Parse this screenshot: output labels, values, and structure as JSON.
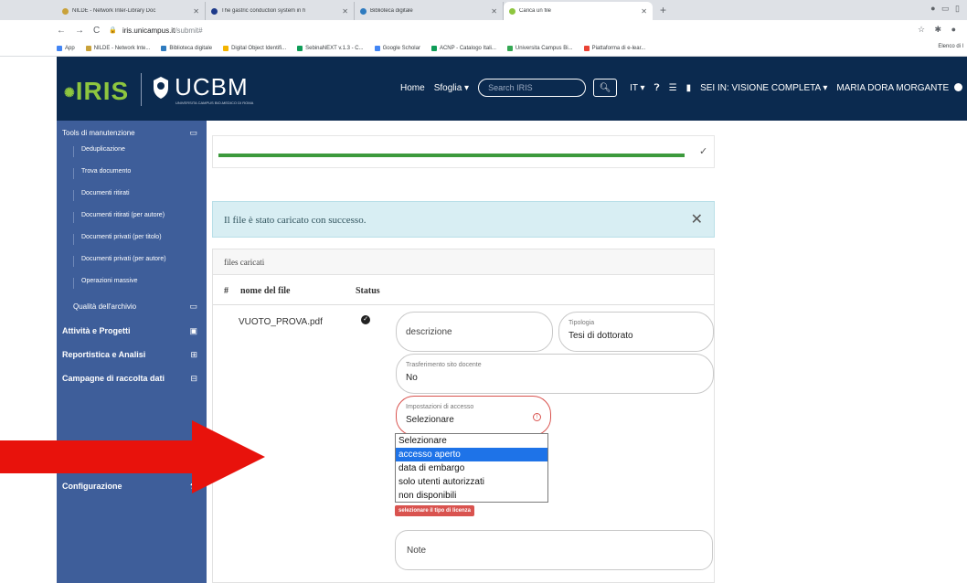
{
  "browser": {
    "tabs": [
      {
        "title": "NILDE - Network Inter-Library Doc",
        "fav": "#c9a23a",
        "active": false
      },
      {
        "title": "The gastric conduction system in h",
        "fav": "#1e3a8a",
        "active": false
      },
      {
        "title": "Biblioteca digitale",
        "fav": "#2e7bbf",
        "active": false
      },
      {
        "title": "Carica un file",
        "fav": "#8ec63f",
        "active": true
      }
    ],
    "url_host": "iris.unicampus.it",
    "url_path": "/submit#",
    "bookmarks": [
      {
        "label": "App",
        "color": "#4285f4"
      },
      {
        "label": "NILDE - Network Inte...",
        "color": "#c9a23a"
      },
      {
        "label": "Biblioteca digitale",
        "color": "#2e7bbf"
      },
      {
        "label": "Digital Object Identifi...",
        "color": "#f4b400"
      },
      {
        "label": "SebinaNEXT v.1.3 - C...",
        "color": "#0f9d58"
      },
      {
        "label": "Google Scholar",
        "color": "#4285f4"
      },
      {
        "label": "ACNP - Catalogo Itali...",
        "color": "#0f9d58"
      },
      {
        "label": "Universita Campus Bi...",
        "color": "#34a853"
      },
      {
        "label": "Piattaforma di e-lear...",
        "color": "#ea4335"
      }
    ],
    "bookmarks_right": "Elenco di l"
  },
  "header": {
    "logo_iris": "IRIS",
    "logo_ucbm": "UCBM",
    "logo_ucbm_sub": "UNIVERSITA CAMPUS BIO-MEDICO DI ROMA",
    "nav_home": "Home",
    "nav_browse": "Sfoglia ▾",
    "search_placeholder": "Search IRIS",
    "lang": "IT ▾",
    "view_mode": "SEI IN: VISIONE COMPLETA ▾",
    "user": "MARIA DORA MORGANTE"
  },
  "sidebar": {
    "tools_title": "Tools di manutenzione",
    "tools_items": [
      "Deduplicazione",
      "Trova documento",
      "Documenti ritirati",
      "Documenti ritirati (per autore)",
      "Documenti privati (per titolo)",
      "Documenti privati (per autore)",
      "Operazioni massive"
    ],
    "archive_quality": "Qualità dell'archivio",
    "activities": "Attività e Progetti",
    "reports": "Reportistica e Analisi",
    "campaigns": "Campagne di raccolta dati",
    "config": "Configurazione"
  },
  "main": {
    "progress_fraction": 0.92,
    "alert_message": "Il file è stato caricato con successo.",
    "panel_title": "files caricati",
    "col_hash": "#",
    "col_filename": "nome del file",
    "col_status": "Status",
    "file_name": "VUOTO_PROVA.pdf",
    "description_placeholder": "descrizione",
    "tipologia_label": "Tipologia",
    "tipologia_value": "Tesi di dottorato",
    "trasf_label": "Trasferimento sito docente",
    "trasf_value": "No",
    "access_label": "Impostazioni di accesso",
    "access_value": "Selezionare",
    "access_options": [
      "Selezionare",
      "accesso aperto",
      "data di embargo",
      "solo utenti autorizzati",
      "non disponibili"
    ],
    "access_selected_index": 1,
    "license_hint": "selezionare il tipo di licenza",
    "notes_placeholder": "Note"
  },
  "colors": {
    "header_bg": "#0b2a4f",
    "sidebar_bg": "#3e5e9a",
    "progress": "#3c9a3c",
    "alert_bg": "#d8eef3",
    "error": "#d9534f",
    "arrow": "#e8120c"
  }
}
